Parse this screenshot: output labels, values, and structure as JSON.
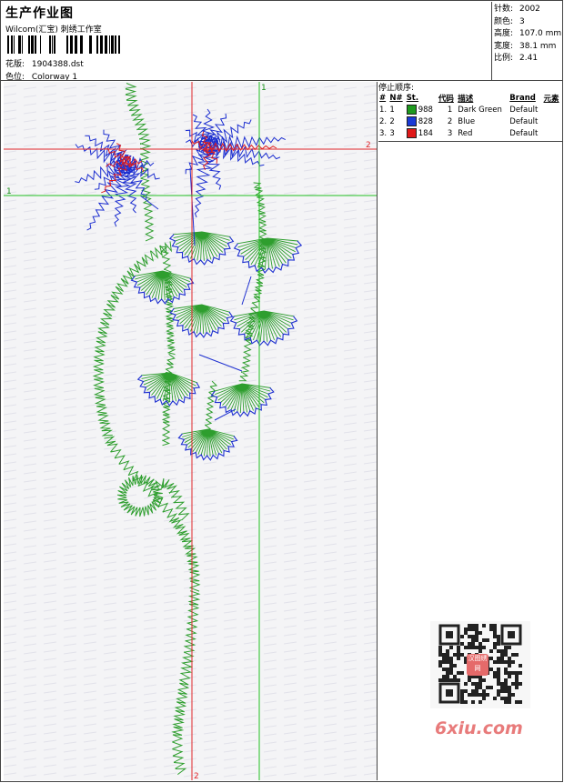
{
  "header": {
    "title": "生产作业图",
    "company": "Wilcom(汇宝) 刺绣工作室",
    "pattern_label": "花版:",
    "pattern_value": "1904388.dst",
    "colorway_label": "色位:",
    "colorway_value": "Colorway 1"
  },
  "stats": [
    {
      "label": "针数:",
      "value": "2002"
    },
    {
      "label": "颜色:",
      "value": "3"
    },
    {
      "label": "高度:",
      "value": "107.0 mm"
    },
    {
      "label": "宽度:",
      "value": "38.1 mm"
    },
    {
      "label": "比例:",
      "value": "2.41"
    }
  ],
  "guides": {
    "red_h_label": "2",
    "red_v_label": "2",
    "green_h_label": "1",
    "green_v_label": "1"
  },
  "stop_sequence": {
    "title": "停止顺序:",
    "headers": [
      "#",
      "N#",
      "St.",
      "代码",
      "描述",
      "Brand",
      "元素"
    ],
    "rows": [
      {
        "idx": "1.",
        "n": "1",
        "color": "#1e9a1e",
        "stitches": "988",
        "code": "1",
        "desc": "Dark Green",
        "brand": "Default"
      },
      {
        "idx": "2.",
        "n": "2",
        "color": "#1a3ad6",
        "stitches": "828",
        "code": "2",
        "desc": "Blue",
        "brand": "Default"
      },
      {
        "idx": "3.",
        "n": "3",
        "color": "#e01818",
        "stitches": "184",
        "code": "3",
        "desc": "Red",
        "brand": "Default"
      }
    ]
  },
  "colors": {
    "green": "#2e9e2e",
    "blue": "#1d2fd0",
    "red": "#e01c1c",
    "guide_red": "#e0262b",
    "guide_green": "#22c022"
  },
  "watermark": {
    "text": "6xiu.com",
    "logo_text": "汉图绣网"
  }
}
